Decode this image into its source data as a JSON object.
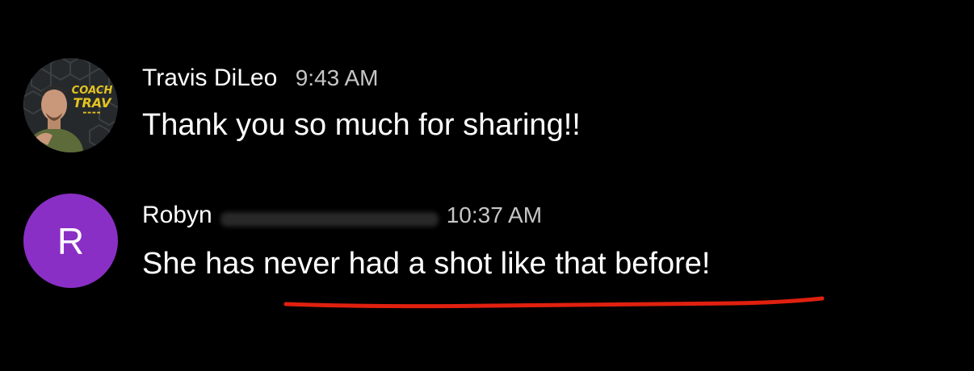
{
  "messages": [
    {
      "author": "Travis DiLeo",
      "time": "9:43 AM",
      "text": "Thank you so much for sharing!!",
      "avatar": {
        "type": "photo",
        "badge_lines": [
          "COACH",
          "TRAV"
        ],
        "badge_color": "#e3c320"
      }
    },
    {
      "author": "Robyn",
      "time": "10:37 AM",
      "text": "She has never had a shot like that before!",
      "avatar": {
        "type": "initial",
        "initial": "R",
        "color": "#8a2fc5"
      }
    }
  ],
  "annotation": {
    "color": "#e0200f"
  }
}
